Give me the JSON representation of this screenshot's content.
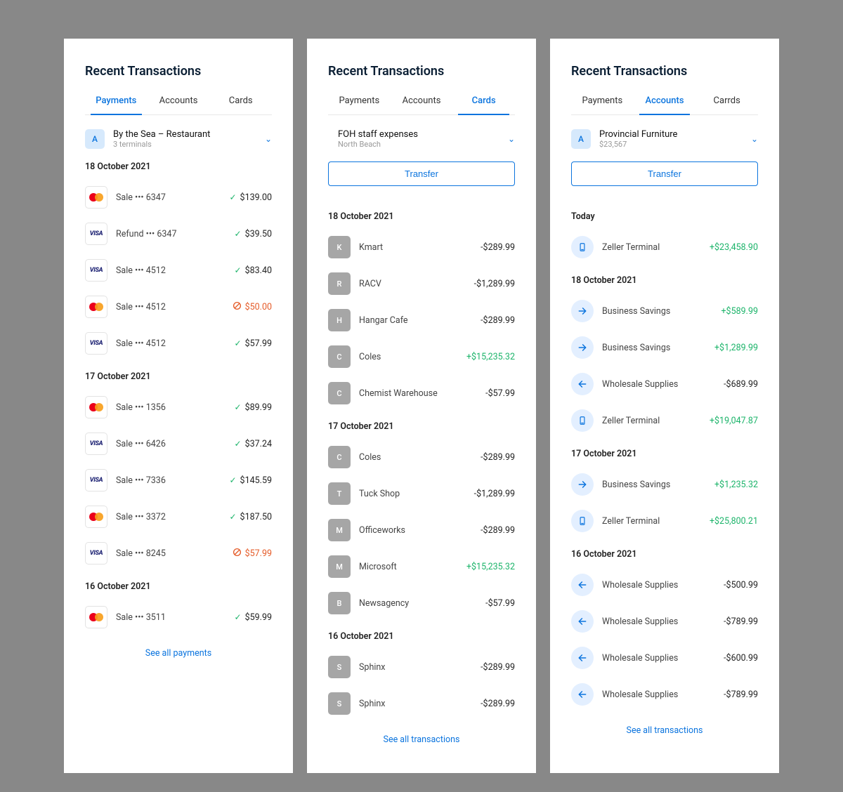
{
  "panels": [
    {
      "title": "Recent Transactions",
      "tabs": [
        "Payments",
        "Accounts",
        "Cards"
      ],
      "active_tab": 0,
      "selector": {
        "avatar": "A",
        "name": "By the Sea – Restaurant",
        "sub": "3 terminals"
      },
      "see_all": "See all payments",
      "groups": [
        {
          "date": "18 October 2021",
          "rows": [
            {
              "card": "mc",
              "label": "Sale ••• 6347",
              "status": "ok",
              "amount": "$139.00"
            },
            {
              "card": "visa",
              "label": "Refund ••• 6347",
              "status": "ok",
              "amount": "$39.50"
            },
            {
              "card": "visa",
              "label": "Sale ••• 4512",
              "status": "ok",
              "amount": "$83.40"
            },
            {
              "card": "mc",
              "label": "Sale ••• 4512",
              "status": "fail",
              "amount": "$50.00"
            },
            {
              "card": "visa",
              "label": "Sale ••• 4512",
              "status": "ok",
              "amount": "$57.99"
            }
          ]
        },
        {
          "date": "17 October 2021",
          "rows": [
            {
              "card": "mc",
              "label": "Sale ••• 1356",
              "status": "ok",
              "amount": "$89.99"
            },
            {
              "card": "visa",
              "label": "Sale ••• 6426",
              "status": "ok",
              "amount": "$37.24"
            },
            {
              "card": "visa",
              "label": "Sale ••• 7336",
              "status": "ok",
              "amount": "$145.59"
            },
            {
              "card": "mc",
              "label": "Sale ••• 3372",
              "status": "ok",
              "amount": "$187.50"
            },
            {
              "card": "visa",
              "label": "Sale ••• 8245",
              "status": "fail",
              "amount": "$57.99"
            }
          ]
        },
        {
          "date": "16 October 2021",
          "rows": [
            {
              "card": "mc",
              "label": "Sale ••• 3511",
              "status": "ok",
              "amount": "$59.99"
            }
          ]
        }
      ]
    },
    {
      "title": "Recent Transactions",
      "tabs": [
        "Payments",
        "Accounts",
        "Cards"
      ],
      "active_tab": 2,
      "selector": {
        "name": "FOH staff expenses",
        "sub": "North Beach"
      },
      "transfer": "Transfer",
      "see_all": "See all transactions",
      "groups": [
        {
          "date": "18 October 2021",
          "rows": [
            {
              "letter": "K",
              "label": "Kmart",
              "amount": "-$289.99"
            },
            {
              "letter": "R",
              "label": "RACV",
              "amount": "-$1,289.99"
            },
            {
              "letter": "H",
              "label": "Hangar Cafe",
              "amount": "-$289.99"
            },
            {
              "letter": "C",
              "label": "Coles",
              "amount": "+$15,235.32",
              "pos": true
            },
            {
              "letter": "C",
              "label": "Chemist Warehouse",
              "amount": "-$57.99"
            }
          ]
        },
        {
          "date": "17 October 2021",
          "rows": [
            {
              "letter": "C",
              "label": "Coles",
              "amount": "-$289.99"
            },
            {
              "letter": "T",
              "label": "Tuck Shop",
              "amount": "-$1,289.99"
            },
            {
              "letter": "M",
              "label": "Officeworks",
              "amount": "-$289.99"
            },
            {
              "letter": "M",
              "label": "Microsoft",
              "amount": "+$15,235.32",
              "pos": true
            },
            {
              "letter": "B",
              "label": "Newsagency",
              "amount": "-$57.99"
            }
          ]
        },
        {
          "date": "16 October 2021",
          "rows": [
            {
              "letter": "S",
              "label": "Sphinx",
              "amount": "-$289.99"
            },
            {
              "letter": "S",
              "label": "Sphinx",
              "amount": "-$289.99"
            }
          ]
        }
      ]
    },
    {
      "title": "Recent Transactions",
      "tabs": [
        "Payments",
        "Accounts",
        "Carrds"
      ],
      "active_tab": 1,
      "selector": {
        "avatar": "A",
        "name": "Provincial Furniture",
        "sub": "$23,567"
      },
      "transfer": "Transfer",
      "see_all": "See all transactions",
      "groups": [
        {
          "date": "Today",
          "rows": [
            {
              "icon": "terminal",
              "label": "Zeller Terminal",
              "amount": "+$23,458.90",
              "pos": true
            }
          ]
        },
        {
          "date": "18 October  2021",
          "rows": [
            {
              "icon": "arrow-right",
              "label": "Business Savings",
              "amount": "+$589.99",
              "pos": true
            },
            {
              "icon": "arrow-right",
              "label": "Business Savings",
              "amount": "+$1,289.99",
              "pos": true
            },
            {
              "icon": "arrow-left",
              "label": "Wholesale Supplies",
              "amount": "-$689.99"
            },
            {
              "icon": "terminal",
              "label": "Zeller Terminal",
              "amount": "+$19,047.87",
              "pos": true
            }
          ]
        },
        {
          "date": "17 October 2021",
          "rows": [
            {
              "icon": "arrow-right",
              "label": "Business Savings",
              "amount": "+$1,235.32",
              "pos": true
            },
            {
              "icon": "terminal",
              "label": "Zeller Terminal",
              "amount": "+$25,800.21",
              "pos": true
            }
          ]
        },
        {
          "date": "16 October 2021",
          "rows": [
            {
              "icon": "arrow-left",
              "label": "Wholesale Supplies",
              "amount": "-$500.99"
            },
            {
              "icon": "arrow-left",
              "label": "Wholesale Supplies",
              "amount": "-$789.99"
            },
            {
              "icon": "arrow-left",
              "label": "Wholesale Supplies",
              "amount": "-$600.99"
            },
            {
              "icon": "arrow-left",
              "label": "Wholesale Supplies",
              "amount": "-$789.99"
            }
          ]
        }
      ]
    }
  ]
}
